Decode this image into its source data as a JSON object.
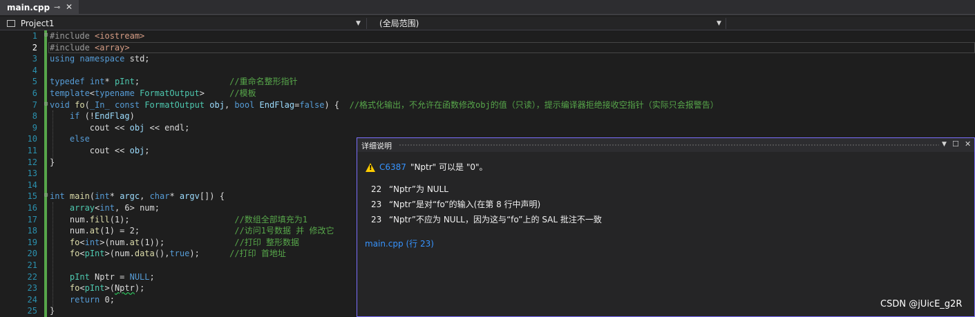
{
  "tab": {
    "title": "main.cpp",
    "pin_icon": "pin-icon",
    "close_icon": "close-icon"
  },
  "navbar": {
    "project": "Project1",
    "scope": "(全局范围)"
  },
  "editor": {
    "current_line": 2
  },
  "popup": {
    "title": "详细说明",
    "code": "C6387",
    "message": "\"Nptr\" 可以是 \"0\"。",
    "details": [
      {
        "line": "22",
        "text": "“Nptr”为 NULL"
      },
      {
        "line": "23",
        "text": "“Nptr”是对“fo”的输入(在第 8 行中声明)"
      },
      {
        "line": "23",
        "text": "“Nptr”不应为 NULL，因为这与“fo”上的 SAL 批注不一致"
      }
    ],
    "location": "main.cpp (行 23)"
  },
  "watermark": "CSDN @jUicE_g2R"
}
